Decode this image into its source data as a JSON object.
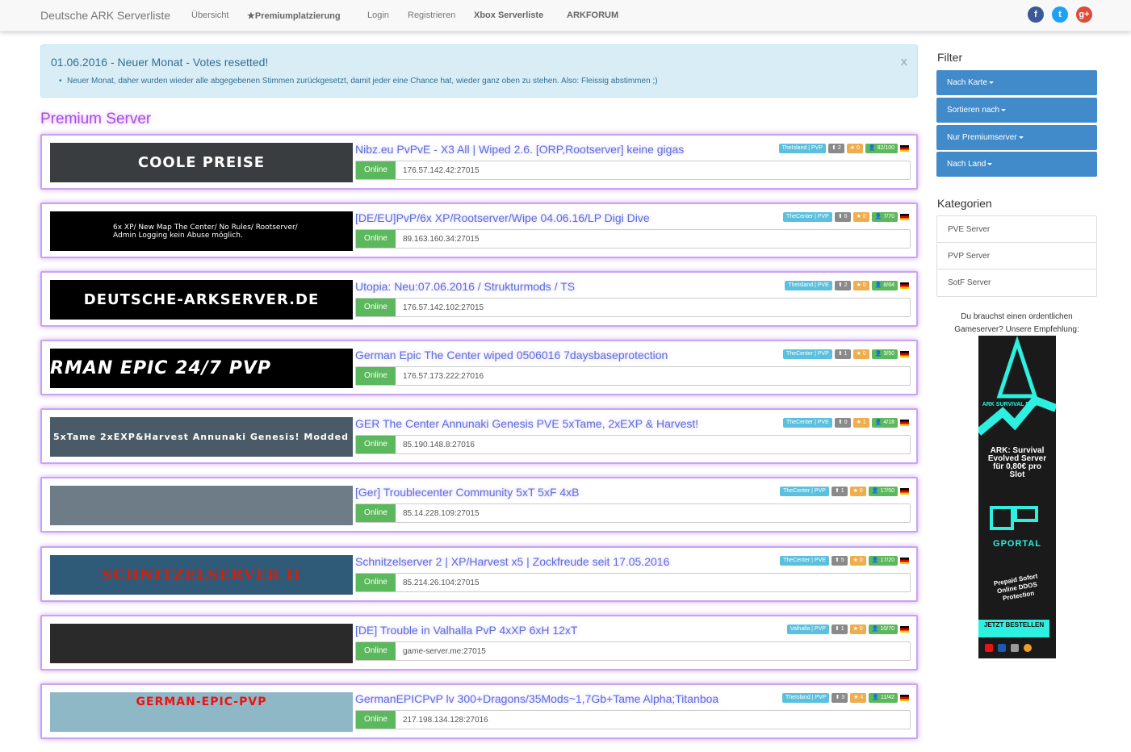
{
  "nav": {
    "brand": "Deutsche ARK Serverliste",
    "items": [
      "Übersicht",
      "★Premiumplatzierung",
      "Login",
      "Registrieren",
      "Xbox Serverliste",
      "ARKFORUM"
    ],
    "social": [
      "f",
      "t",
      "g+"
    ]
  },
  "alert": {
    "title": "01.06.2016 - Neuer Monat - Votes resetted!",
    "close": "x",
    "text": "Neuer Monat, daher wurden wieder alle abgegebenen Stimmen zurückgesetzt, damit jeder eine Chance hat, wieder ganz oben zu stehen. Also: Fleissig abstimmen ;)"
  },
  "section_title": "Premium Server",
  "status_label": "Online",
  "servers": [
    {
      "title": "Nibz.eu PvPvE - X3 All | Wiped 2.6. [ORP,Rootserver] keine gigas",
      "map": "TheIsland | PVP",
      "up": "2",
      "stars": "0",
      "players": "82/100",
      "ip": "176.57.142.42:27015",
      "banner": "COOLE   PREISE",
      "banner_bg": "#3a3d3f"
    },
    {
      "title": "[DE/EU]PvP/6x XP/Rootserver/Wipe 04.06.16/LP Digi Dive",
      "map": "TheCenter | PVP",
      "up": "6",
      "stars": "0",
      "players": "7/70",
      "ip": "89.163.160.34:27015",
      "banner": "6x XP/ New Map The Center/ No Rules/ Rootserver/ Admin Logging kein Abuse möglich.",
      "banner_bg": "#000000"
    },
    {
      "title": "Utopia: Neu:07.06.2016 / Strukturmods / TS",
      "map": "TheIsland | PVE",
      "up": "2",
      "stars": "0",
      "players": "8/64",
      "ip": "176.57.142.102:27015",
      "banner": "DEUTSCHE-ARKSERVER.DE",
      "banner_bg": "#000000"
    },
    {
      "title": "German Epic The Center wiped 0506016 7daysbaseprotection",
      "map": "TheCenter | PVP",
      "up": "1",
      "stars": "0",
      "players": "3/50",
      "ip": "176.57.173.222:27016",
      "banner": "RMAN EPIC 24/7 PVP",
      "banner_bg": "#000000"
    },
    {
      "title": "GER The Center Annunaki Genesis PVE 5xTame, 2xEXP & Harvest!",
      "map": "TheCenter | PVE",
      "up": "0",
      "stars": "1",
      "players": "4/18",
      "ip": "85.190.148.8:27016",
      "banner": "5xTame 2xEXP&Harvest  Annunaki Genesis! Modded",
      "banner_bg": "#4a5a66"
    },
    {
      "title": "[Ger] Troublecenter Community 5xT 5xF 4xB",
      "map": "TheCenter | PVP",
      "up": "1",
      "stars": "0",
      "players": "17/50",
      "ip": "85.14.228.109:27015",
      "banner": "",
      "banner_bg": "#6d7c86"
    },
    {
      "title": "Schnitzelserver 2 | XP/Harvest x5 | Zockfreude seit 17.05.2016",
      "map": "TheCenter | PVE",
      "up": "5",
      "stars": "0",
      "players": "17/20",
      "ip": "85.214.26.104:27015",
      "banner": "SCHNITZELSERVER II",
      "banner_bg": "#2f5a78"
    },
    {
      "title": "[DE] Trouble in Valhalla PvP 4xXP 6xH 12xT",
      "map": "Valhalla | PVP",
      "up": "1",
      "stars": "0",
      "players": "10/70",
      "ip": "game-server.me:27015",
      "banner": "",
      "banner_bg": "#2a2a2a"
    },
    {
      "title": "GermanEPICPvP lv 300+Dragons/35Mods~1,7Gb+Tame Alpha;Titanboa",
      "map": "TheIsland | PVP",
      "up": "3",
      "stars": "4",
      "players": "11/42",
      "ip": "217.198.134.128:27016",
      "banner": "GERMAN-EPIC-PVP",
      "banner_bg": "#8fb8c7"
    }
  ],
  "sidebar": {
    "filter_heading": "Filter",
    "filters": [
      "Nach Karte",
      "Sortieren nach",
      "Nur Premiumserver",
      "Nach Land"
    ],
    "categories_heading": "Kategorien",
    "categories": [
      "PVE Server",
      "PVP Server",
      "SotF Server"
    ],
    "ad_text": "Du brauchst einen ordentlichen Gameserver? Unsere Empfehlung:",
    "ad": {
      "brand_top": "ARK SURVIVAL EVOLVED",
      "headline": "ARK: Survival Evolved Server für 0,80€ pro Slot",
      "provider": "GPORTAL",
      "features": "Prepaid Sofort Online DDOS Protection",
      "cta": "JETZT BESTELLEN"
    }
  },
  "colors": {
    "accent": "#428bca",
    "online": "#5cb85c",
    "premium_glow": "#a64ddf",
    "alert_bg": "#d9edf7"
  }
}
